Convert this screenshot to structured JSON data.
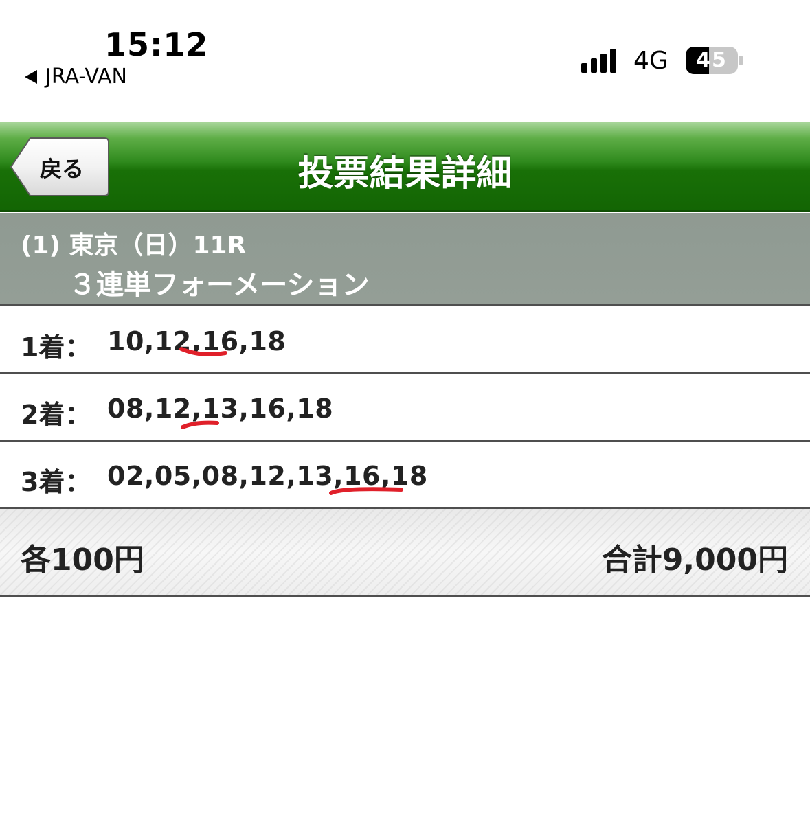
{
  "status_bar": {
    "time": "15:12",
    "back_app_label": "JRA-VAN",
    "network": "4G",
    "battery_percent": "45",
    "battery_level": 0.45,
    "signal_bars": 4
  },
  "nav": {
    "back_label": "戻る",
    "title": "投票結果詳細"
  },
  "race": {
    "line1": "(1) 東京（日）11R",
    "bet_type": "３連単フォーメーション"
  },
  "finishes": [
    {
      "position": "1着：",
      "numbers": "10,12,16,18",
      "marked": "16"
    },
    {
      "position": "2着：",
      "numbers": "08,12,13,16,18",
      "marked": "13"
    },
    {
      "position": "3着：",
      "numbers": "02,05,08,12,13,16,18",
      "marked": "18"
    }
  ],
  "footer": {
    "unit_price": "各100円",
    "total": "合計9,000円"
  },
  "colors": {
    "nav_green": "#197007",
    "header_gray": "#949e96",
    "marker_red": "#e0202a"
  }
}
